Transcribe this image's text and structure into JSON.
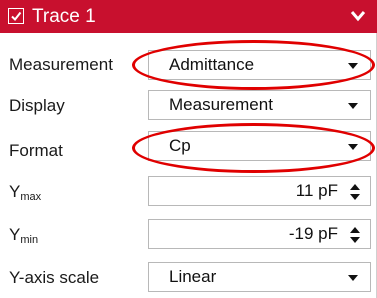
{
  "header": {
    "title": "Trace 1",
    "checked": true,
    "icon_check": "check-icon",
    "icon_collapse": "chevron-down-icon"
  },
  "rows": [
    {
      "label": "Measurement",
      "value": "Admittance",
      "kind": "dropdown"
    },
    {
      "label": "Display",
      "value": "Measurement",
      "kind": "dropdown"
    },
    {
      "label": "Format",
      "value": "Cp",
      "kind": "dropdown"
    },
    {
      "label_main": "Y",
      "label_sub": "max",
      "value": "11 pF",
      "kind": "spinner"
    },
    {
      "label_main": "Y",
      "label_sub": "min",
      "value": "-19 pF",
      "kind": "spinner"
    },
    {
      "label": "Y-axis scale",
      "value": "Linear",
      "kind": "dropdown"
    }
  ],
  "colors": {
    "header_bg": "#c8102e",
    "highlight_ring": "#e00000"
  }
}
